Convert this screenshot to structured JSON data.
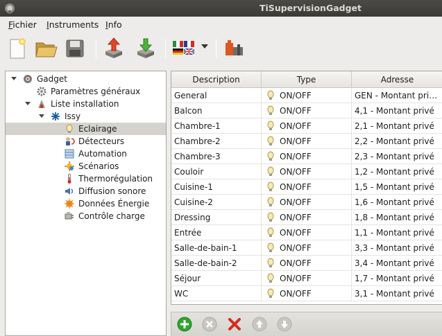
{
  "window": {
    "title": "TiSupervisionGadget"
  },
  "menu": [
    {
      "label": "Fichier",
      "mnemonic": "F",
      "rest": "ichier"
    },
    {
      "label": "Instruments",
      "mnemonic": "I",
      "rest": "nstruments"
    },
    {
      "label": "Info",
      "mnemonic": "I",
      "rest": "nfo"
    }
  ],
  "toolbar": {
    "buttons": [
      "new-document-icon",
      "open-folder-icon",
      "save-icon",
      "upload-icon",
      "download-icon",
      "language-flags-icon",
      "tisupervision-logo-icon"
    ]
  },
  "tree": {
    "items": [
      {
        "label": "Gadget",
        "icon": "gadget-icon"
      },
      {
        "label": "Paramètres généraux",
        "icon": "settings-icon"
      },
      {
        "label": "Liste installation",
        "icon": "installation-icon"
      },
      {
        "label": "Issy",
        "icon": "network-icon"
      },
      {
        "label": "Eclairage",
        "icon": "bulb-icon"
      },
      {
        "label": "Détecteurs",
        "icon": "detector-icon"
      },
      {
        "label": "Automation",
        "icon": "automation-icon"
      },
      {
        "label": "Scénarios",
        "icon": "scenario-icon"
      },
      {
        "label": "Thermorégulation",
        "icon": "thermometer-icon"
      },
      {
        "label": "Diffusion sonore",
        "icon": "speaker-icon"
      },
      {
        "label": "Données Énergie",
        "icon": "energy-icon"
      },
      {
        "label": "Contrôle charge",
        "icon": "load-control-icon"
      }
    ]
  },
  "table": {
    "columns": [
      "Description",
      "Type",
      "Adresse"
    ],
    "rows": [
      {
        "description": "General",
        "type": "ON/OFF",
        "address": "GEN - Montant privé..."
      },
      {
        "description": "Balcon",
        "type": "ON/OFF",
        "address": "4,1 - Montant privé"
      },
      {
        "description": "Chambre-1",
        "type": "ON/OFF",
        "address": "2,1 - Montant privé"
      },
      {
        "description": "Chambre-2",
        "type": "ON/OFF",
        "address": "2,2 - Montant privé"
      },
      {
        "description": "Chambre-3",
        "type": "ON/OFF",
        "address": "2,3 - Montant privé"
      },
      {
        "description": "Couloir",
        "type": "ON/OFF",
        "address": "1,2 - Montant privé"
      },
      {
        "description": "Cuisine-1",
        "type": "ON/OFF",
        "address": "1,5 - Montant privé"
      },
      {
        "description": "Cuisine-2",
        "type": "ON/OFF",
        "address": "1,6 - Montant privé"
      },
      {
        "description": "Dressing",
        "type": "ON/OFF",
        "address": "1,8 - Montant privé"
      },
      {
        "description": "Entrée",
        "type": "ON/OFF",
        "address": "1,1 - Montant privé"
      },
      {
        "description": "Salle-de-bain-1",
        "type": "ON/OFF",
        "address": "3,3 - Montant privé"
      },
      {
        "description": "Salle-de-bain-2",
        "type": "ON/OFF",
        "address": "3,4 - Montant privé"
      },
      {
        "description": "Séjour",
        "type": "ON/OFF",
        "address": "1,7 - Montant privé"
      },
      {
        "description": "WC",
        "type": "ON/OFF",
        "address": "3,1 - Montant privé"
      }
    ]
  },
  "actions": [
    "add-icon",
    "remove-icon",
    "delete-icon",
    "move-up-icon",
    "move-down-icon"
  ],
  "colors": {
    "add": "#2ea52e",
    "delete": "#d42b1e",
    "disabled": "#b9b7b1",
    "selection": "#d5d3cd"
  }
}
